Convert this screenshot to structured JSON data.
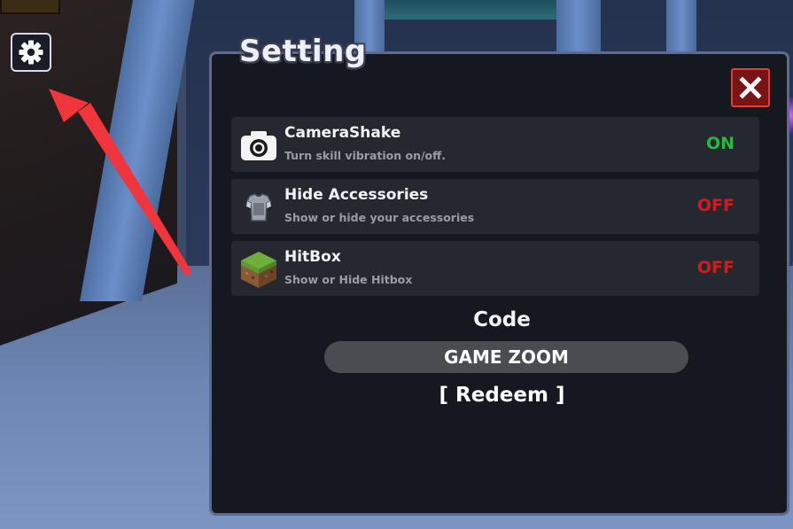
{
  "hud": {
    "settings_button_icon": "gear-icon"
  },
  "settings": {
    "title": "Setting",
    "close_icon": "close-icon",
    "colors": {
      "on": "#1fbf3a",
      "off": "#d31b1b",
      "panel_border": "#5d6c8e",
      "close_bg": "#7a1313"
    },
    "rows": [
      {
        "icon": "camera-icon",
        "title": "CameraShake",
        "description": "Turn skill vibration on/off.",
        "status": "ON"
      },
      {
        "icon": "armor-icon",
        "title": "Hide Accessories",
        "description": "Show or hide your accessories",
        "status": "OFF"
      },
      {
        "icon": "grass-block-icon",
        "title": "HitBox",
        "description": "Show or Hide Hitbox",
        "status": "OFF"
      }
    ],
    "code": {
      "label": "Code",
      "value": "GAME ZOOM",
      "redeem_label": "[ Redeem ]"
    }
  }
}
